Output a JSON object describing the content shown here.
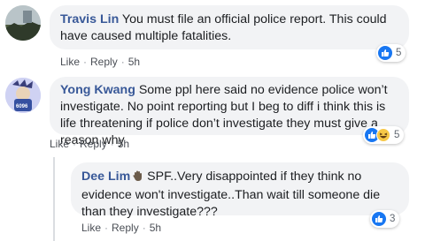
{
  "comments": [
    {
      "author": "Travis Lin",
      "text": "You must file an official police report. This could have caused multiple fatalities.",
      "actions": {
        "like": "Like",
        "reply": "Reply",
        "time": "5h"
      },
      "reaction_count": "5"
    },
    {
      "author": "Yong Kwang",
      "text": "Some ppl here said no evidence police won’t investigate. No point reporting but I beg to diff i think this is life threatening if police don’t investigate they must give a reason why",
      "actions": {
        "like": "Like",
        "reply": "Reply",
        "time": "5h"
      },
      "reaction_count": "5",
      "avatar_badge": "6096"
    },
    {
      "author": "Dee Lim",
      "text": "SPF..Very disappointed if they think no evidence won't investigate..Than wait till someone die than they investigate???",
      "actions": {
        "like": "Like",
        "reply": "Reply",
        "time": "5h"
      },
      "reaction_count": "3"
    }
  ],
  "separator": "·",
  "colors": {
    "author": "#385898",
    "bubble": "#f2f3f5",
    "like_blue": "#1877f2"
  }
}
